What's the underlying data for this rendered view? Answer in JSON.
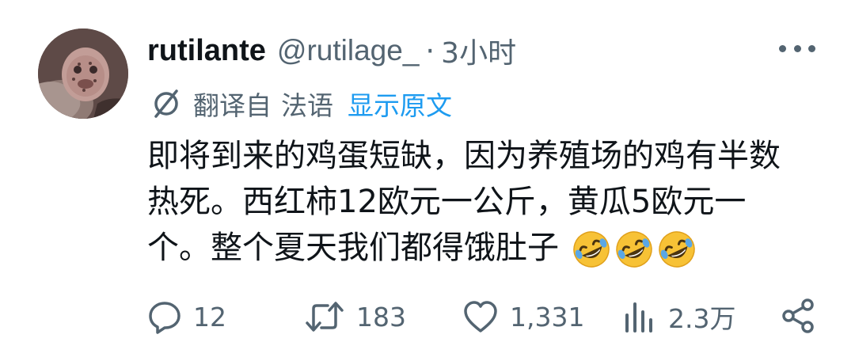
{
  "author": {
    "display_name": "rutilante",
    "handle": "@rutilage_",
    "separator": "·",
    "time": "3小时"
  },
  "translation": {
    "label": "翻译自",
    "language": "法语",
    "show_original": "显示原文"
  },
  "tweet": {
    "lines": [
      "即将到来的鸡蛋短缺，因为养殖场的鸡有半数",
      "热死。西红柿12欧元一公斤，黄瓜5欧元一",
      "个。整个夏天我们都得饿肚子"
    ],
    "emoji_count": 3
  },
  "actions": {
    "replies": "12",
    "retweets": "183",
    "likes": "1,331",
    "views": "2.3万"
  },
  "colors": {
    "text": "#0f1419",
    "secondary": "#536471",
    "link": "#1d9bf0"
  }
}
